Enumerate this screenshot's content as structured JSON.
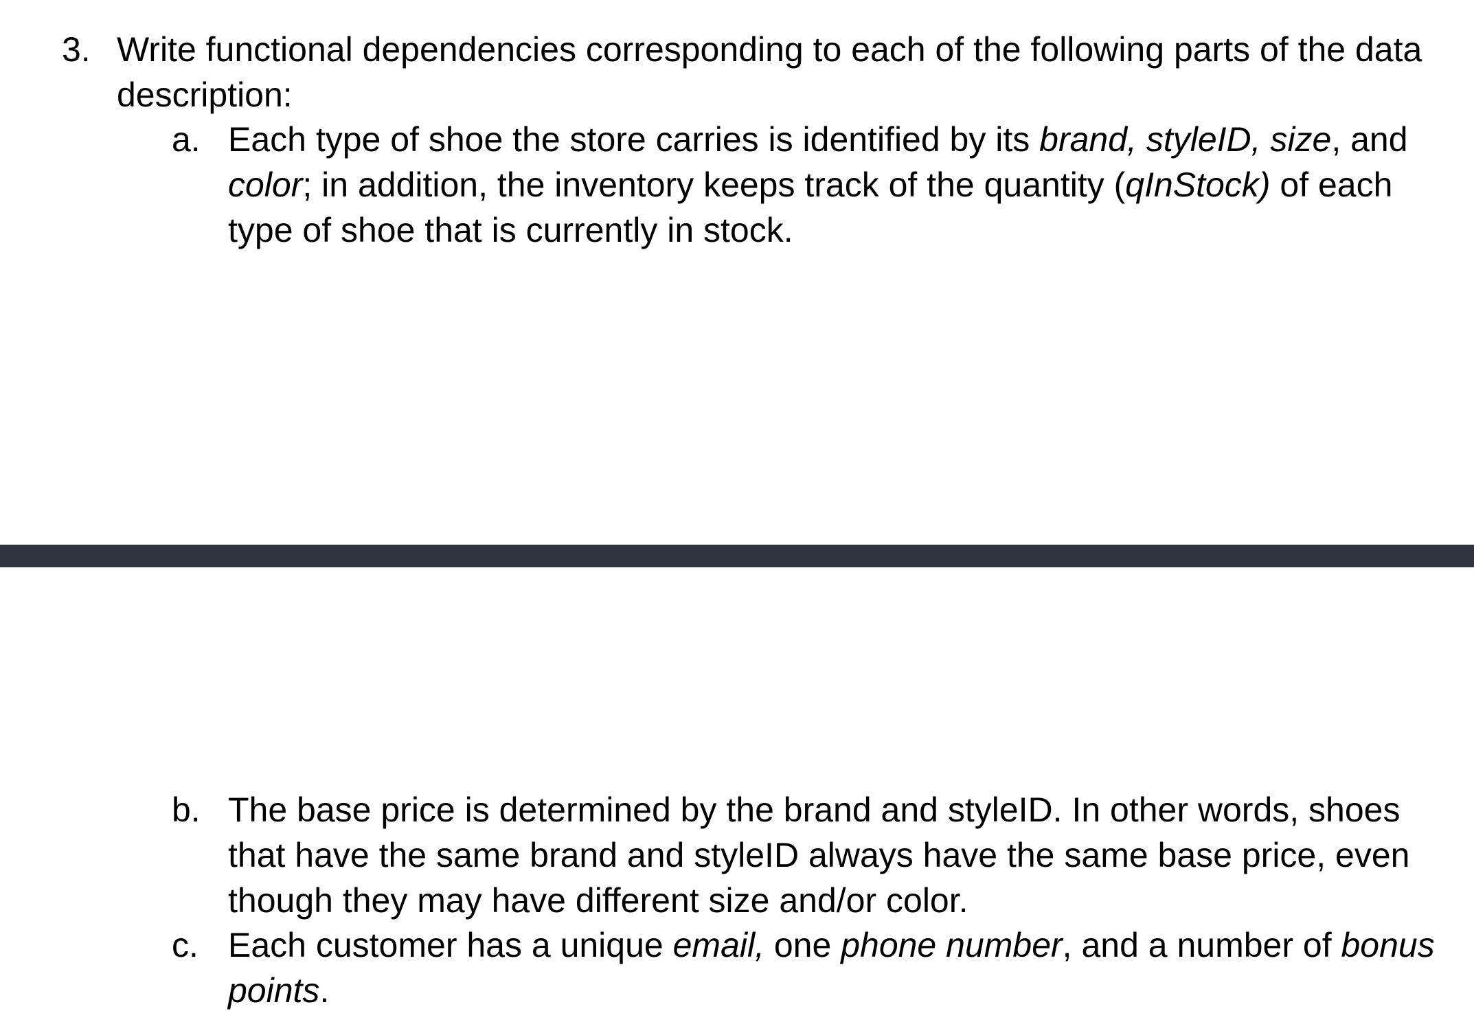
{
  "question": {
    "number": "3.",
    "lines": [
      "Write functional dependencies corresponding to each of the following parts of the data",
      "description:"
    ]
  },
  "items": [
    {
      "letter": "a.",
      "line1_a": "Each type of shoe the store carries is identified by its ",
      "line1_b": "brand, styleID, size",
      "line1_c": ", and",
      "line2_a": "color",
      "line2_b": "; in addition, the inventory keeps track of the quantity (",
      "line2_c": "qInStock)",
      "line2_d": " of each",
      "line3": "type of shoe that is currently in stock."
    },
    {
      "letter": "b.",
      "line1": "The base price is determined by the brand and styleID.  In other words, shoes",
      "line2": "that have the same brand and styleID always have the same base price, even",
      "line3": "though they may have different size and/or color."
    },
    {
      "letter": "c.",
      "line1_a": "Each customer has a unique ",
      "line1_b": "email,",
      "line1_c": " one ",
      "line1_d": "phone number",
      "line1_e": ", and a number of ",
      "line1_f": "bonus",
      "line2_a": "points",
      "line2_b": "."
    }
  ],
  "colors": {
    "divider": "#2e3440",
    "text": "#000000",
    "background": "#ffffff"
  }
}
